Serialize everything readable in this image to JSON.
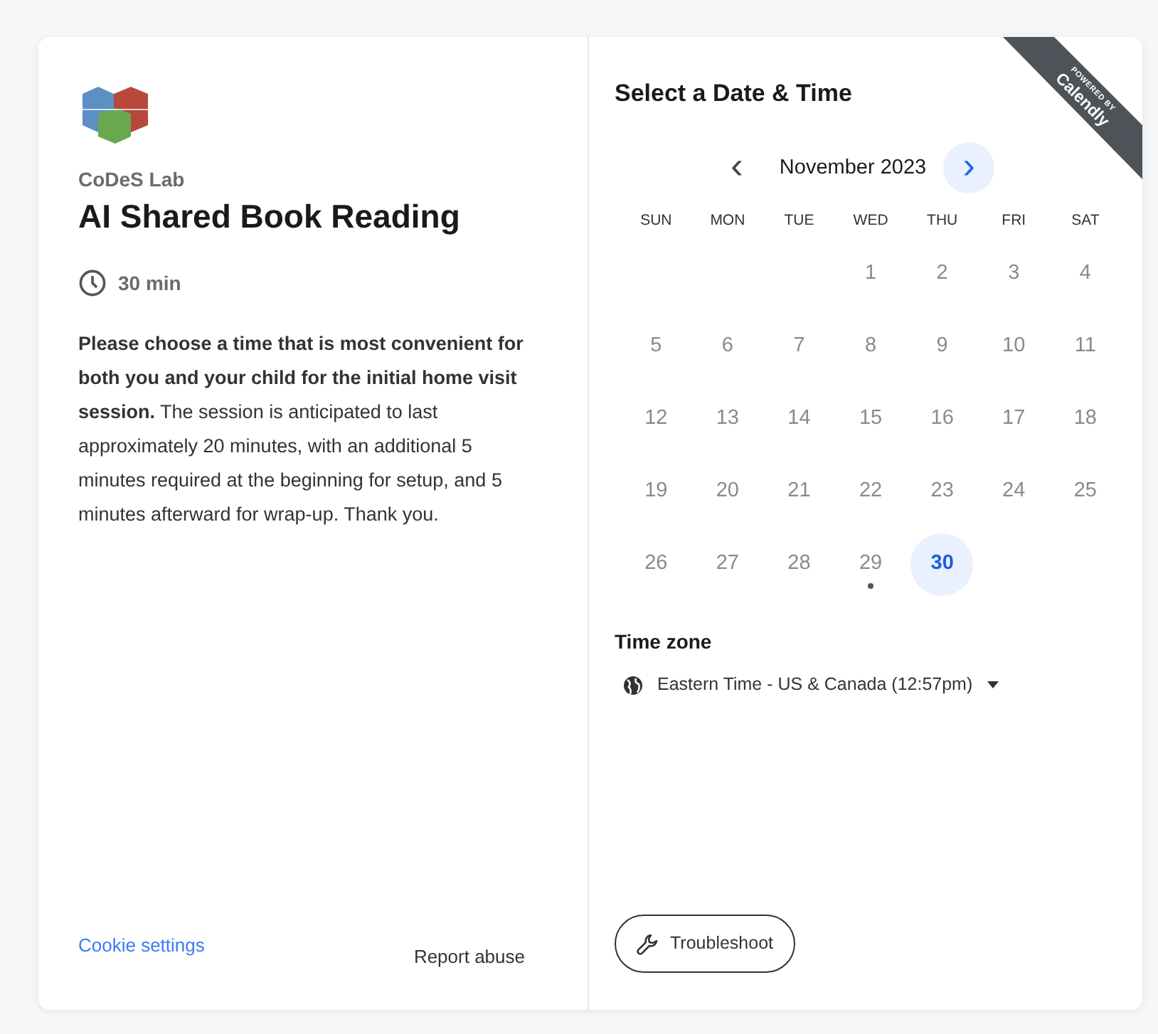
{
  "branding": {
    "powered_by": "POWERED BY",
    "brand": "Calendly"
  },
  "event": {
    "organizer": "CoDeS Lab",
    "title": "AI Shared Book Reading",
    "duration": "30 min",
    "description": "**Please choose a time that is most convenient for both you and your child for the initial home visit session.** The session is anticipated to last approximately 20 minutes, with an additional 5 minutes required at the beginning for setup, and 5 minutes afterward for wrap-up. Thank you."
  },
  "footer_links": {
    "cookie_settings": "Cookie settings",
    "report_abuse": "Report abuse"
  },
  "scheduler": {
    "heading": "Select a Date & Time",
    "month": "November 2023",
    "prev_button": "‹",
    "next_button": "›",
    "weekdays": [
      "SUN",
      "MON",
      "TUE",
      "WED",
      "THU",
      "FRI",
      "SAT"
    ],
    "weeks": [
      {
        "align_end": true,
        "days": [
          {
            "day": "1",
            "available": false,
            "selected": false,
            "today": false
          },
          {
            "day": "2",
            "available": false,
            "selected": false,
            "today": false
          },
          {
            "day": "3",
            "available": false,
            "selected": false,
            "today": false
          },
          {
            "day": "4",
            "available": false,
            "selected": false,
            "today": false
          }
        ]
      },
      {
        "days": [
          {
            "day": "5",
            "available": false,
            "selected": false,
            "today": false
          },
          {
            "day": "6",
            "available": false,
            "selected": false,
            "today": false
          },
          {
            "day": "7",
            "available": false,
            "selected": false,
            "today": false
          },
          {
            "day": "8",
            "available": false,
            "selected": false,
            "today": false
          },
          {
            "day": "9",
            "available": false,
            "selected": false,
            "today": false
          },
          {
            "day": "10",
            "available": false,
            "selected": false,
            "today": false
          },
          {
            "day": "11",
            "available": false,
            "selected": false,
            "today": false
          }
        ]
      },
      {
        "days": [
          {
            "day": "12",
            "available": false,
            "selected": false,
            "today": false
          },
          {
            "day": "13",
            "available": false,
            "selected": false,
            "today": false
          },
          {
            "day": "14",
            "available": false,
            "selected": false,
            "today": false
          },
          {
            "day": "15",
            "available": false,
            "selected": false,
            "today": false
          },
          {
            "day": "16",
            "available": false,
            "selected": false,
            "today": false
          },
          {
            "day": "17",
            "available": false,
            "selected": false,
            "today": false
          },
          {
            "day": "18",
            "available": false,
            "selected": false,
            "today": false
          }
        ]
      },
      {
        "days": [
          {
            "day": "19",
            "available": false,
            "selected": false,
            "today": false
          },
          {
            "day": "20",
            "available": false,
            "selected": false,
            "today": false
          },
          {
            "day": "21",
            "available": false,
            "selected": false,
            "today": false
          },
          {
            "day": "22",
            "available": false,
            "selected": false,
            "today": false
          },
          {
            "day": "23",
            "available": false,
            "selected": false,
            "today": false
          },
          {
            "day": "24",
            "available": false,
            "selected": false,
            "today": false
          },
          {
            "day": "25",
            "available": false,
            "selected": false,
            "today": false
          }
        ]
      },
      {
        "align_end": false,
        "days": [
          {
            "day": "26",
            "available": false,
            "selected": false,
            "today": false
          },
          {
            "day": "27",
            "available": false,
            "selected": false,
            "today": false
          },
          {
            "day": "28",
            "available": false,
            "selected": false,
            "today": false
          },
          {
            "day": "29",
            "available": false,
            "selected": false,
            "today": true
          },
          {
            "day": "30",
            "available": true,
            "selected": false,
            "today": false
          }
        ]
      }
    ],
    "timezone_label": "Time zone",
    "timezone": "Eastern Time - US & Canada (12:57pm)",
    "troubleshoot_button": "Troubleshoot"
  }
}
